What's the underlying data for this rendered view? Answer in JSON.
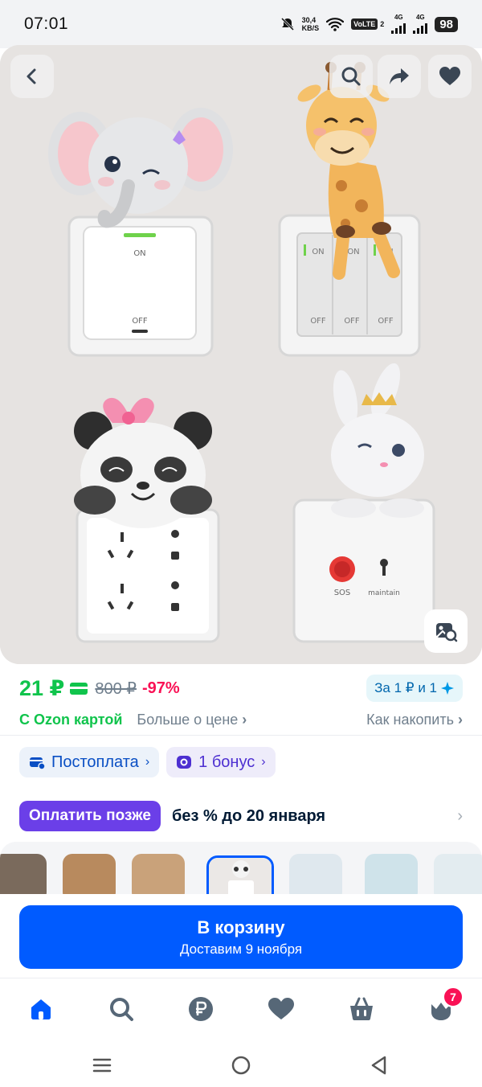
{
  "status_bar": {
    "time": "07:01",
    "net_speed_value": "30,4",
    "net_speed_unit": "KB/S",
    "volte": "VoLTE",
    "sim_index": "2",
    "net_type_1": "4G",
    "net_type_2": "4G",
    "battery": "98"
  },
  "gallery": {
    "switch_on_label": "ON",
    "switch_off_label": "OFF",
    "sos_label": "SOS",
    "maintain_label": "maintain"
  },
  "price": {
    "current": "21 ₽",
    "old": "800 ₽",
    "discount": "-97%",
    "bonus_chip": "За 1 ₽ и 1",
    "ozon_card": "С Ozon картой",
    "more_about_price": "Больше о цене",
    "how_to_earn": "Как накопить",
    "accent_green": "#10c44c",
    "accent_red": "#f91155"
  },
  "chips": {
    "postpay": "Постоплата",
    "bonus": "1 бонус"
  },
  "pay_later": {
    "badge": "Оплатить позже",
    "text": "без % до 20 января"
  },
  "cart": {
    "button_title": "В корзину",
    "button_subtitle": "Доставим 9 ноября",
    "brand_blue": "#005bff"
  },
  "bottom_nav": {
    "items": [
      "home-icon",
      "search-icon",
      "ruble-icon",
      "heart-icon",
      "cart-icon",
      "profile-icon"
    ],
    "cart_badge": "7"
  }
}
